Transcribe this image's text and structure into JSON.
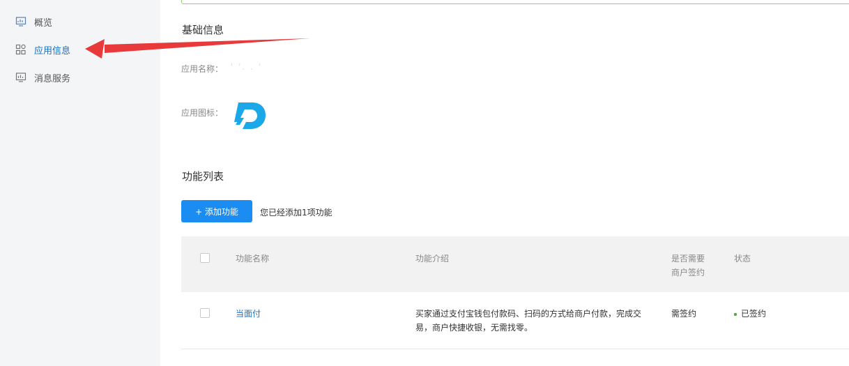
{
  "sidebar": {
    "items": [
      {
        "label": "概览",
        "icon": "monitor-icon",
        "active": false
      },
      {
        "label": "应用信息",
        "icon": "grid-apps-icon",
        "active": true
      },
      {
        "label": "消息服务",
        "icon": "bar-monitor-icon",
        "active": false
      }
    ]
  },
  "basic_info": {
    "title": "基础信息",
    "app_name_label": "应用名称：",
    "app_name_value": "' '. . '",
    "app_icon_label": "应用图标：",
    "app_icon": "app-logo-icon"
  },
  "features": {
    "title": "功能列表",
    "add_button": "+ 添加功能",
    "added_hint": "您已经添加1项功能",
    "columns": {
      "name": "功能名称",
      "desc": "功能介绍",
      "sign_line1": "是否需要",
      "sign_line2": "商户签约",
      "status": "状态"
    },
    "rows": [
      {
        "name": "当面付",
        "desc_line1": "买家通过支付宝钱包付款码、扫码的方式给商户付款，完成交",
        "desc_line2": "易，商户快捷收银，无需找零。",
        "sign": "需签约",
        "status": "已签约"
      }
    ]
  },
  "colors": {
    "accent": "#1b8cf2",
    "link": "#1a6fc2",
    "status_ok": "#4fb040",
    "annotation_arrow": "#e8393b",
    "logo": "#1aa8e8"
  }
}
